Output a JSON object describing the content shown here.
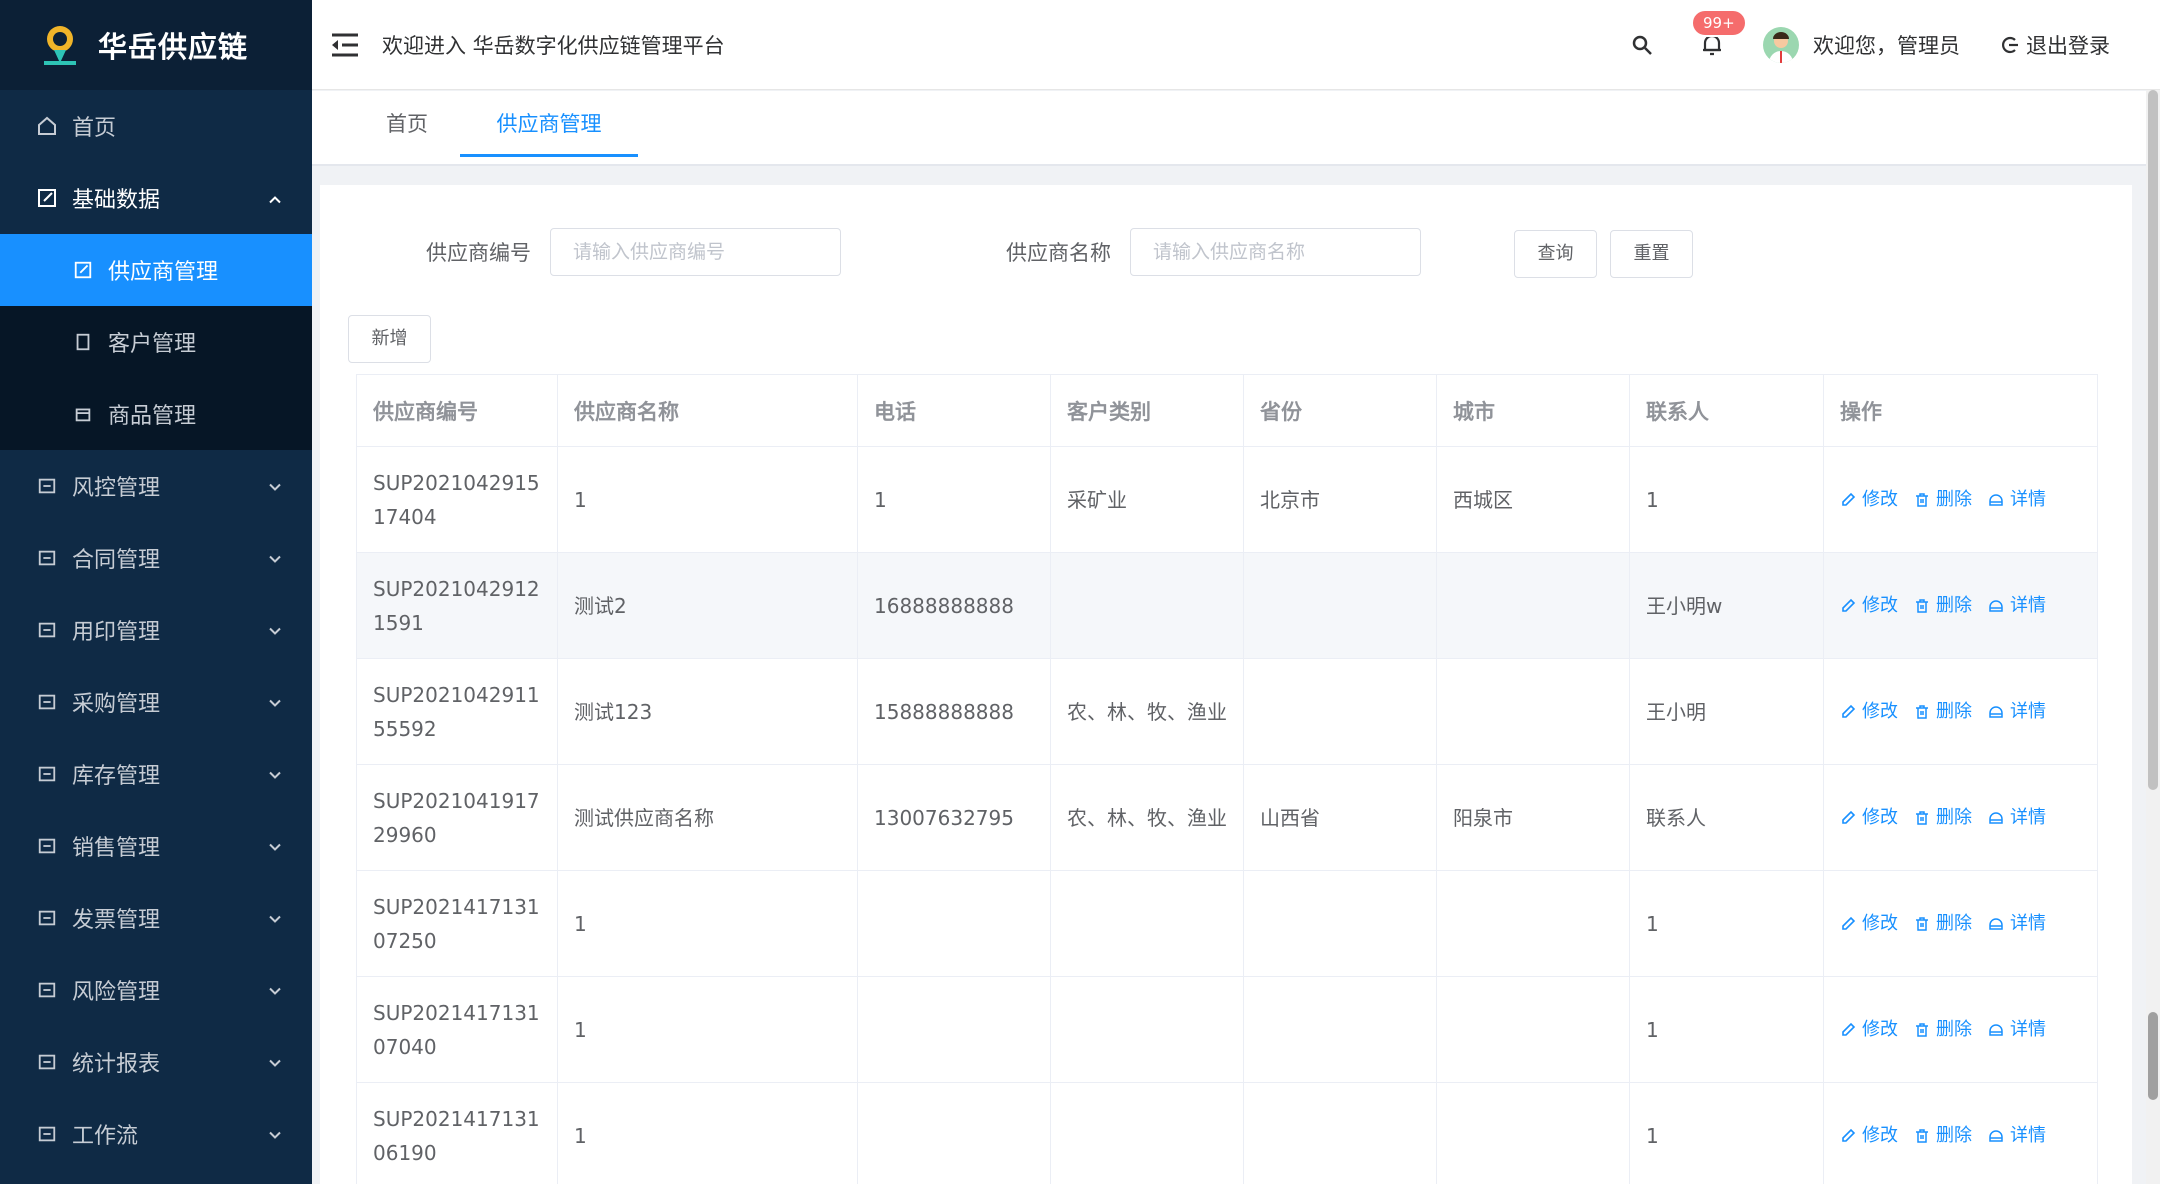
{
  "brand": {
    "name": "华岳供应链"
  },
  "header": {
    "welcome": "欢迎进入 华岳数字化供应链管理平台",
    "badge": "99+",
    "user_greeting": "欢迎您，管理员",
    "logout": "退出登录"
  },
  "sidebar": {
    "home": "首页",
    "basic": "基础数据",
    "basic_children": [
      "供应商管理",
      "客户管理",
      "商品管理"
    ],
    "groups": [
      "风控管理",
      "合同管理",
      "用印管理",
      "采购管理",
      "库存管理",
      "销售管理",
      "发票管理",
      "风险管理",
      "统计报表",
      "工作流"
    ]
  },
  "tabs": [
    "首页",
    "供应商管理"
  ],
  "search": {
    "code_label": "供应商编号",
    "code_placeholder": "请输入供应商编号",
    "name_label": "供应商名称",
    "name_placeholder": "请输入供应商名称",
    "query": "查询",
    "reset": "重置",
    "add": "新增"
  },
  "table": {
    "columns": [
      "供应商编号",
      "供应商名称",
      "电话",
      "客户类别",
      "省份",
      "城市",
      "联系人",
      "操作"
    ],
    "actions": [
      "修改",
      "删除",
      "详情"
    ],
    "rows": [
      {
        "code": "SUP202104291517404",
        "name": "1",
        "phone": "1",
        "category": "采矿业",
        "province": "北京市",
        "city": "西城区",
        "contact": "1"
      },
      {
        "code": "SUP20210429121591",
        "name": "测试2",
        "phone": "16888888888",
        "category": "",
        "province": "",
        "city": "",
        "contact": "王小明w"
      },
      {
        "code": "SUP202104291155592",
        "name": "测试123",
        "phone": "15888888888",
        "category": "农、林、牧、渔业",
        "province": "",
        "city": "",
        "contact": "王小明"
      },
      {
        "code": "SUP202104191729960",
        "name": "测试供应商名称",
        "phone": "13007632795",
        "category": "农、林、牧、渔业",
        "province": "山西省",
        "city": "阳泉市",
        "contact": "联系人"
      },
      {
        "code": "SUP202141713107250",
        "name": "1",
        "phone": "",
        "category": "",
        "province": "",
        "city": "",
        "contact": "1"
      },
      {
        "code": "SUP202141713107040",
        "name": "1",
        "phone": "",
        "category": "",
        "province": "",
        "city": "",
        "contact": "1"
      },
      {
        "code": "SUP202141713106190",
        "name": "1",
        "phone": "",
        "category": "",
        "province": "",
        "city": "",
        "contact": "1"
      }
    ]
  },
  "colors": {
    "sidebar": "#0f2a45",
    "active": "#1890ff",
    "badge": "#f56c6c"
  }
}
